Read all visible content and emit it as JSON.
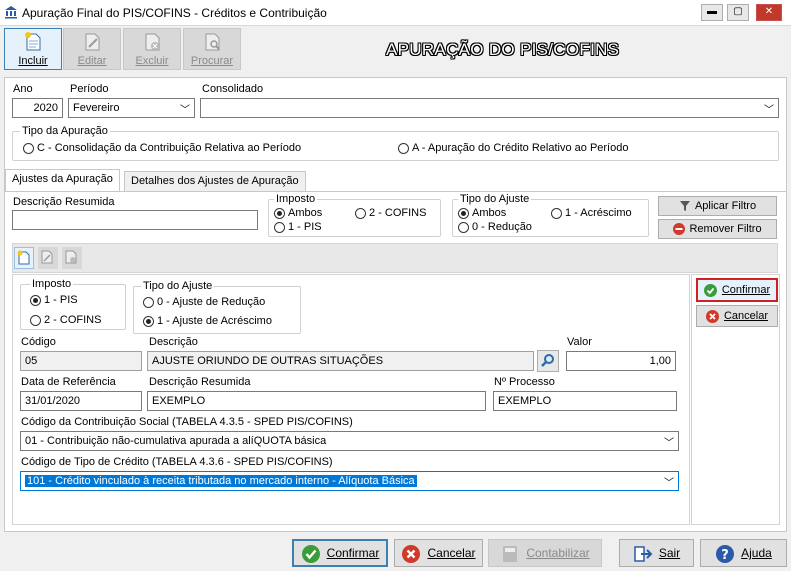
{
  "window": {
    "title": "Apuração Final do PIS/COFINS - Créditos e Contribuição"
  },
  "toolbar": {
    "incluir": "Incluir",
    "editar": "Editar",
    "excluir": "Excluir",
    "procurar": "Procurar",
    "heading": "APURAÇÃO DO PIS/COFINS"
  },
  "header": {
    "ano_label": "Ano",
    "ano_value": "2020",
    "periodo_label": "Período",
    "periodo_value": "Fevereiro",
    "consolidado_label": "Consolidado",
    "consolidado_value": ""
  },
  "tipo_apuracao": {
    "title": "Tipo da Apuração",
    "option_c": "C - Consolidação da Contribuição Relativa ao Período",
    "option_a": "A - Apuração do Crédito Relativo ao Período"
  },
  "tabs": {
    "ajustes": "Ajustes da Apuração",
    "detalhes": "Detalhes dos Ajustes de Apuração"
  },
  "filter": {
    "descricao_label": "Descrição Resumida",
    "descricao_value": "",
    "imposto_title": "Imposto",
    "imposto_ambos": "Ambos",
    "imposto_cofins": "2 - COFINS",
    "imposto_pis": "1 - PIS",
    "tipo_title": "Tipo do Ajuste",
    "tipo_ambos": "Ambos",
    "tipo_acrescimo": "1 - Acréscimo",
    "tipo_reducao": "0 - Redução",
    "aplicar": "Aplicar Filtro",
    "remover": "Remover Filtro"
  },
  "form": {
    "imposto_title": "Imposto",
    "imposto_pis": "1 - PIS",
    "imposto_cofins": "2 - COFINS",
    "tipo_title": "Tipo do Ajuste",
    "tipo_reducao": "0 - Ajuste de Redução",
    "tipo_acrescimo": "1 - Ajuste de Acréscimo",
    "codigo_label": "Código",
    "codigo_value": "05",
    "descricao_label": "Descrição",
    "descricao_value": "AJUSTE ORIUNDO DE OUTRAS SITUAÇÕES",
    "valor_label": "Valor",
    "valor_value": "1,00",
    "data_label": "Data de Referência",
    "data_value": "31/01/2020",
    "desc_resumida_label": "Descrição Resumida",
    "desc_resumida_value": "EXEMPLO",
    "processo_label": "Nº Processo",
    "processo_value": "EXEMPLO",
    "contrib_label": "Código da Contribuição Social (TABELA 4.3.5 - SPED PIS/COFINS)",
    "contrib_value": "01 - Contribuição não-cumulativa apurada a alíQUOTA básica",
    "credito_label": "Código de Tipo de Crédito (TABELA 4.3.6 - SPED PIS/COFINS)",
    "credito_value": "101 - Crédito vinculado à receita tributada no mercado interno - Alíquota Básica"
  },
  "side": {
    "confirmar": "Confirmar",
    "cancelar": "Cancelar"
  },
  "bottom": {
    "confirmar": "Confirmar",
    "cancelar": "Cancelar",
    "contabilizar": "Contabilizar",
    "sair": "Sair",
    "ajuda": "Ajuda"
  },
  "colors": {
    "accent": "#0078d7",
    "focus_border": "#d02020",
    "ok_green": "#3a9d3a",
    "cancel_red": "#d03a2a"
  }
}
